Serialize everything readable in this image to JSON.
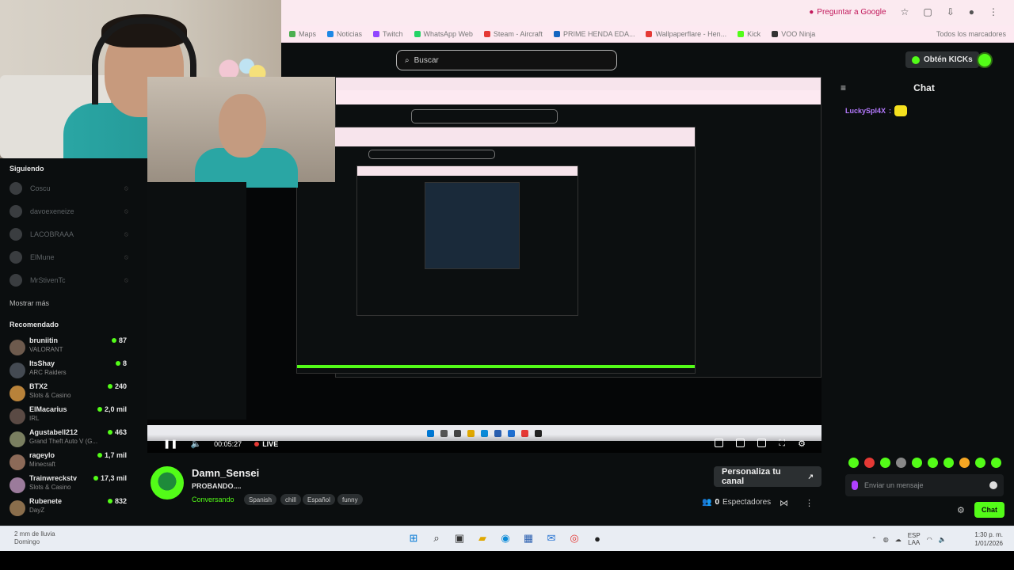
{
  "browser": {
    "ask_google": "Preguntar a Google",
    "bookmarks": [
      {
        "label": "Maps",
        "color": "#4caf50"
      },
      {
        "label": "Noticias",
        "color": "#1e88e5"
      },
      {
        "label": "Twitch",
        "color": "#9146ff"
      },
      {
        "label": "WhatsApp Web",
        "color": "#25d366"
      },
      {
        "label": "Steam - Aircraft",
        "color": "#e53935"
      },
      {
        "label": "PRIME HENDA EDA...",
        "color": "#1565c0"
      },
      {
        "label": "Wallpaperflare - Hen...",
        "color": "#e53935"
      },
      {
        "label": "Kick",
        "color": "#53fc18"
      },
      {
        "label": "VOO Ninja",
        "color": "#333333"
      }
    ],
    "all_bookmarks": "Todos los marcadores"
  },
  "header": {
    "search_placeholder": "Buscar",
    "kicks_button": "Obtén KICKs"
  },
  "sidebar": {
    "following_title": "Siguiendo",
    "following": [
      "Coscu",
      "davoexeneize",
      "LACOBRAAA",
      "ElMune",
      "MrStivenTc"
    ],
    "show_more": "Mostrar más",
    "recommended_title": "Recomendado",
    "recommended": [
      {
        "name": "bruniitin",
        "category": "VALORANT",
        "viewers": "87",
        "color": "#6d5a4d"
      },
      {
        "name": "ItsShay",
        "category": "ARC Raiders",
        "viewers": "8",
        "color": "#444a52"
      },
      {
        "name": "BTX2",
        "category": "Slots & Casino",
        "viewers": "240",
        "color": "#b8823a"
      },
      {
        "name": "ElMacarius",
        "category": "IRL",
        "viewers": "2,0 mil",
        "color": "#5a4a44"
      },
      {
        "name": "Agustabell212",
        "category": "Grand Theft Auto V (G...",
        "viewers": "463",
        "color": "#7a7f60"
      },
      {
        "name": "rageylo",
        "category": "Minecraft",
        "viewers": "1,7 mil",
        "color": "#8c6a58"
      },
      {
        "name": "Trainwreckstv",
        "category": "Slots & Casino",
        "viewers": "17,3 mil",
        "color": "#9b7b9b"
      },
      {
        "name": "Rubenete",
        "category": "DayZ",
        "viewers": "832",
        "color": "#8a6e4c"
      }
    ]
  },
  "player": {
    "time": "00:05:27",
    "live_label": "LIVE"
  },
  "stream": {
    "channel": "Damn_Sensei",
    "title": "PROBANDO....",
    "category": "Conversando",
    "tags": [
      "Spanish",
      "chill",
      "Español",
      "funny"
    ],
    "customize_button": "Personaliza tu canal",
    "viewers_count": "0",
    "viewers_label": "Espectadores"
  },
  "chat": {
    "title": "Chat",
    "messages": [
      {
        "user": "LuckySpl4X",
        "colon": ":"
      }
    ],
    "input_placeholder": "Enviar un mensaje",
    "send_button": "Chat",
    "emote_colors": [
      "#53fc18",
      "#e53935",
      "#53fc18",
      "#888888",
      "#53fc18",
      "#53fc18",
      "#53fc18",
      "#f5a623",
      "#53fc18",
      "#53fc18"
    ]
  },
  "taskbar": {
    "weather_line1": "2 mm de lluvia",
    "weather_line2": "Domingo",
    "lang_line1": "ESP",
    "lang_line2": "LAA",
    "time": "1:30 p. m.",
    "date": "1/01/2026"
  },
  "colors": {
    "accent": "#53fc18",
    "background": "#0b0e0f",
    "chrome": "#fbeaf0"
  }
}
